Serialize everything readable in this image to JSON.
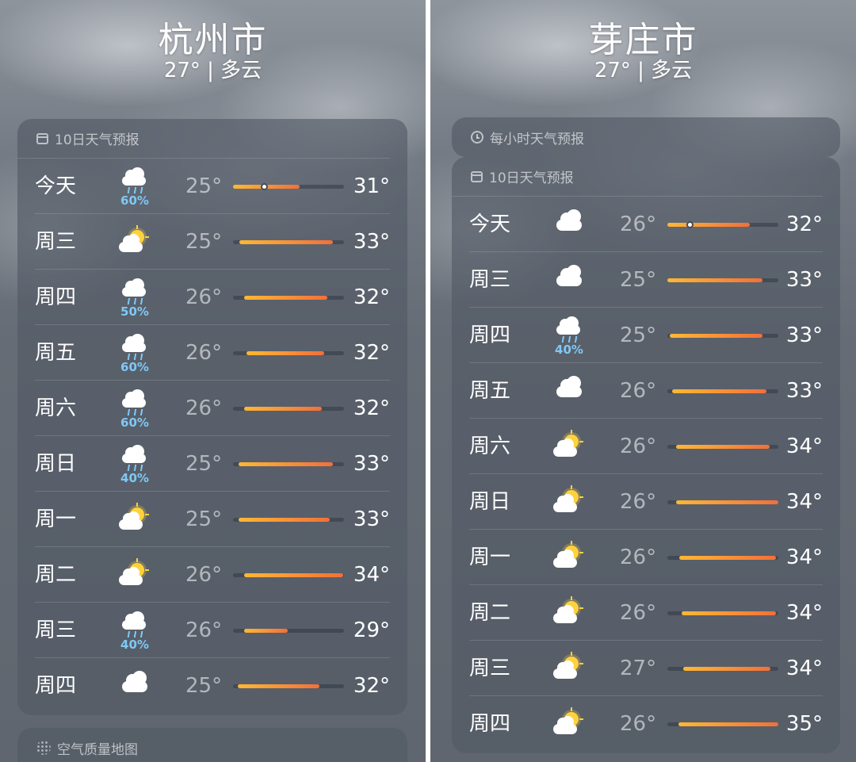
{
  "left": {
    "city": "杭州市",
    "condition": "27° | 多云",
    "forecast_title": "10日天气预报",
    "aq_title": "空气质量地图",
    "days": [
      {
        "day": "今天",
        "icon": "rain-cloud-icon",
        "pct": "60%",
        "lo": "25°",
        "hi": "31°",
        "bar": [
          0.0,
          0.6
        ],
        "now": 0.28
      },
      {
        "day": "周三",
        "icon": "partly-sunny-icon",
        "pct": "",
        "lo": "25°",
        "hi": "33°",
        "bar": [
          0.06,
          0.9
        ]
      },
      {
        "day": "周四",
        "icon": "rain-cloud-icon",
        "pct": "50%",
        "lo": "26°",
        "hi": "32°",
        "bar": [
          0.1,
          0.85
        ]
      },
      {
        "day": "周五",
        "icon": "rain-cloud-icon",
        "pct": "60%",
        "lo": "26°",
        "hi": "32°",
        "bar": [
          0.12,
          0.82
        ]
      },
      {
        "day": "周六",
        "icon": "rain-cloud-icon",
        "pct": "60%",
        "lo": "26°",
        "hi": "32°",
        "bar": [
          0.1,
          0.8
        ]
      },
      {
        "day": "周日",
        "icon": "rain-cloud-icon",
        "pct": "40%",
        "lo": "25°",
        "hi": "33°",
        "bar": [
          0.05,
          0.9
        ]
      },
      {
        "day": "周一",
        "icon": "partly-sunny-icon",
        "pct": "",
        "lo": "25°",
        "hi": "33°",
        "bar": [
          0.05,
          0.87
        ]
      },
      {
        "day": "周二",
        "icon": "partly-sunny-icon",
        "pct": "",
        "lo": "26°",
        "hi": "34°",
        "bar": [
          0.1,
          0.99
        ]
      },
      {
        "day": "周三",
        "icon": "rain-cloud-icon",
        "pct": "40%",
        "lo": "26°",
        "hi": "29°",
        "bar": [
          0.1,
          0.49
        ]
      },
      {
        "day": "周四",
        "icon": "cloud-icon",
        "pct": "",
        "lo": "25°",
        "hi": "32°",
        "bar": [
          0.04,
          0.78
        ]
      }
    ]
  },
  "right": {
    "city": "芽庄市",
    "condition": "27° | 多云",
    "hourly_title": "每小时天气预报",
    "forecast_title": "10日天气预报",
    "days": [
      {
        "day": "今天",
        "icon": "cloud-icon",
        "pct": "",
        "lo": "26°",
        "hi": "32°",
        "bar": [
          0.0,
          0.74
        ],
        "now": 0.2
      },
      {
        "day": "周三",
        "icon": "cloud-icon",
        "pct": "",
        "lo": "25°",
        "hi": "33°",
        "bar": [
          0.0,
          0.86
        ]
      },
      {
        "day": "周四",
        "icon": "rain-cloud-icon",
        "pct": "40%",
        "lo": "25°",
        "hi": "33°",
        "bar": [
          0.02,
          0.86
        ]
      },
      {
        "day": "周五",
        "icon": "cloud-icon",
        "pct": "",
        "lo": "26°",
        "hi": "33°",
        "bar": [
          0.04,
          0.89
        ]
      },
      {
        "day": "周六",
        "icon": "partly-sunny-icon",
        "pct": "",
        "lo": "26°",
        "hi": "34°",
        "bar": [
          0.08,
          0.92
        ]
      },
      {
        "day": "周日",
        "icon": "partly-sunny-icon",
        "pct": "",
        "lo": "26°",
        "hi": "34°",
        "bar": [
          0.08,
          1.0
        ]
      },
      {
        "day": "周一",
        "icon": "partly-sunny-icon",
        "pct": "",
        "lo": "26°",
        "hi": "34°",
        "bar": [
          0.11,
          0.98
        ]
      },
      {
        "day": "周二",
        "icon": "partly-sunny-icon",
        "pct": "",
        "lo": "26°",
        "hi": "34°",
        "bar": [
          0.13,
          0.98
        ]
      },
      {
        "day": "周三",
        "icon": "partly-sunny-icon",
        "pct": "",
        "lo": "27°",
        "hi": "34°",
        "bar": [
          0.14,
          0.93
        ]
      },
      {
        "day": "周四",
        "icon": "partly-sunny-icon",
        "pct": "",
        "lo": "26°",
        "hi": "35°",
        "bar": [
          0.1,
          1.0
        ]
      }
    ]
  },
  "colors": {
    "bar_start": "#ffb834",
    "bar_end": "#f26f3a",
    "rain_pct": "#7fc8f5"
  }
}
